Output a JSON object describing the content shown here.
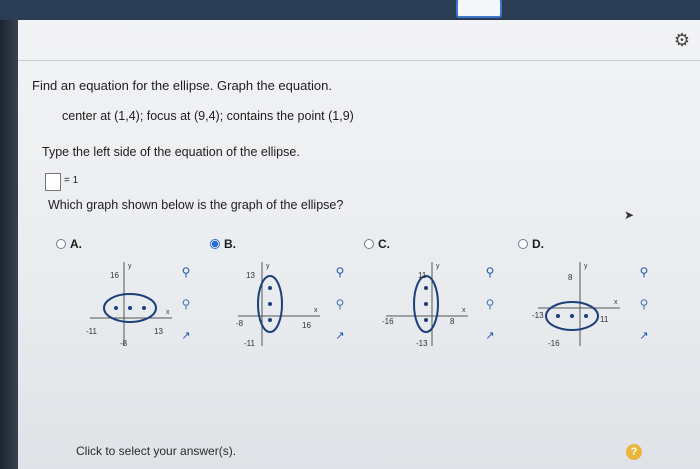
{
  "header": {
    "right_text": ""
  },
  "question": {
    "title": "Find an equation for the ellipse. Graph the equation.",
    "given": "center at (1,4); focus at (9,4); contains the point (1,9)",
    "instruction": "Type the left side of the equation of the ellipse.",
    "equation_suffix": "= 1",
    "answer_value": "",
    "which_graph": "Which graph shown below is the graph of the ellipse?"
  },
  "options": [
    {
      "letter": "A.",
      "selected": false,
      "y_top": "16",
      "y_bottom": "-8",
      "x_left": "-11",
      "x_right": "13"
    },
    {
      "letter": "B.",
      "selected": true,
      "y_top": "13",
      "y_bottom": "-11",
      "x_left": "-8",
      "x_right": "16"
    },
    {
      "letter": "C.",
      "selected": false,
      "y_top": "11",
      "y_bottom": "-13",
      "x_left": "-16",
      "x_right": "8"
    },
    {
      "letter": "D.",
      "selected": false,
      "y_top": "8",
      "y_bottom": "-16",
      "x_left": "-13",
      "x_right": "11"
    }
  ],
  "axis_labels": {
    "x": "x",
    "y": "y"
  },
  "footer": {
    "prompt": "Click to select your answer(s).",
    "help": "?"
  },
  "icons": [
    "gear-icon",
    "zoom-in-icon",
    "zoom-out-icon",
    "popout-icon",
    "help-icon"
  ],
  "colors": {
    "accent": "#2c6fce",
    "ellipse": "#1b3f7a",
    "help": "#e9b53b"
  }
}
